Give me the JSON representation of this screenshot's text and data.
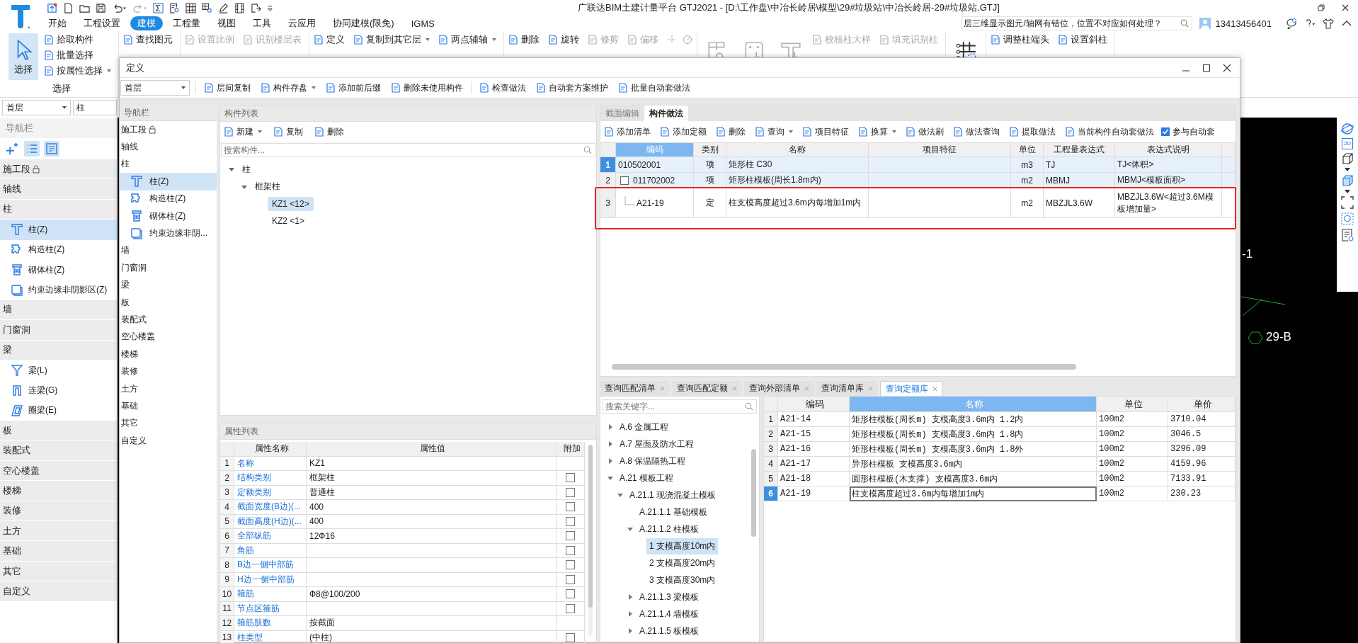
{
  "app": {
    "title": "广联达BIM土建计量平台 GTJ2021 - [D:\\工作盘\\中冶长岭居\\模型\\29#垃圾站\\中冶长岭居-29#垃圾站.GTJ]",
    "menu_tabs": [
      {
        "label": "开始",
        "selected": false
      },
      {
        "label": "工程设置",
        "selected": false
      },
      {
        "label": "建模",
        "selected": true
      },
      {
        "label": "工程量",
        "selected": false
      },
      {
        "label": "视图",
        "selected": false
      },
      {
        "label": "工具",
        "selected": false
      },
      {
        "label": "云应用",
        "selected": false
      },
      {
        "label": "协同建模(限免)",
        "selected": false
      },
      {
        "label": "IGMS",
        "selected": false
      }
    ],
    "help_search": {
      "value": "层三维显示图元/轴网有错位，位置不对应如何处理？"
    },
    "user": "13413456401"
  },
  "ribbon": [
    {
      "label": "选择",
      "large": [
        {
          "label": "选择",
          "kind": "pointer",
          "selected": true,
          "disabled": false
        }
      ],
      "cols": [
        [
          {
            "label": "拾取构件",
            "disabled": false,
            "dropdown": false
          },
          {
            "label": "批量选择",
            "disabled": false,
            "dropdown": false
          },
          {
            "label": "按属性选择",
            "disabled": false,
            "dropdown": true
          }
        ]
      ]
    },
    {
      "cols": [
        [
          {
            "label": "查找图元",
            "disabled": false,
            "dropdown": false
          }
        ]
      ]
    },
    {
      "cols": [
        [
          {
            "label": "设置比例",
            "disabled": true,
            "dropdown": false
          }
        ],
        [
          {
            "label": "识别楼层表",
            "disabled": true,
            "dropdown": false
          }
        ]
      ]
    },
    {
      "cols": [
        [
          {
            "label": "定义",
            "disabled": false,
            "dropdown": false
          }
        ],
        [
          {
            "label": "复制到其它层",
            "disabled": false,
            "dropdown": true
          }
        ],
        [
          {
            "label": "两点辅轴",
            "disabled": false,
            "dropdown": true
          }
        ]
      ]
    },
    {
      "cols": [
        [
          {
            "label": "删除",
            "disabled": false,
            "dropdown": false
          }
        ],
        [
          {
            "label": "旋转",
            "disabled": false,
            "dropdown": false
          }
        ],
        [
          {
            "label": "修剪",
            "disabled": true,
            "dropdown": false
          }
        ],
        [
          {
            "label": "偏移",
            "disabled": true,
            "dropdown": false
          }
        ]
      ]
    },
    {
      "large": [
        {
          "kind": "grid-search",
          "selected": false,
          "disabled": true
        },
        {
          "kind": "point-box",
          "selected": false,
          "disabled": true
        },
        {
          "kind": "column-pick",
          "selected": false,
          "disabled": true
        }
      ],
      "cols": [
        [
          {
            "label": "校核柱大样",
            "disabled": true,
            "dropdown": false
          }
        ],
        [
          {
            "label": "填充识别柱",
            "disabled": true,
            "dropdown": false
          }
        ]
      ]
    },
    {
      "large": [
        {
          "kind": "axis-grid",
          "selected": false,
          "disabled": false
        }
      ]
    },
    {
      "cols": [
        [
          {
            "label": "调整柱端头",
            "disabled": false,
            "dropdown": false
          }
        ],
        [
          {
            "label": "设置斜柱",
            "disabled": false,
            "dropdown": false
          }
        ]
      ]
    }
  ],
  "floor_select": {
    "value": "首层"
  },
  "type_select": {
    "value": "柱"
  },
  "nav": {
    "title": "导航栏",
    "groups": [
      {
        "label": "施工段",
        "locked": true
      },
      {
        "label": "轴线",
        "locked": false
      },
      {
        "label": "柱",
        "locked": false,
        "children": [
          {
            "label": "柱(Z)",
            "kind": "column",
            "selected": true
          },
          {
            "label": "构造柱(Z)",
            "kind": "constructional",
            "selected": false
          },
          {
            "label": "砌体柱(Z)",
            "kind": "masonry",
            "selected": false
          },
          {
            "label": "约束边缘非阴影区(Z)",
            "kind": "edge",
            "selected": false
          }
        ]
      },
      {
        "label": "墙",
        "locked": false
      },
      {
        "label": "门窗洞",
        "locked": false
      },
      {
        "label": "梁",
        "locked": false,
        "children": [
          {
            "label": "梁(L)",
            "kind": "beam",
            "selected": false
          },
          {
            "label": "连梁(G)",
            "kind": "link-beam",
            "selected": false
          },
          {
            "label": "圈梁(E)",
            "kind": "ring-beam",
            "selected": false
          }
        ]
      },
      {
        "label": "板",
        "locked": false
      },
      {
        "label": "装配式",
        "locked": false
      },
      {
        "label": "空心楼盖",
        "locked": false
      },
      {
        "label": "楼梯",
        "locked": false
      },
      {
        "label": "装修",
        "locked": false
      },
      {
        "label": "土方",
        "locked": false
      },
      {
        "label": "基础",
        "locked": false
      },
      {
        "label": "其它",
        "locked": false
      },
      {
        "label": "自定义",
        "locked": false
      }
    ]
  },
  "canvas": {
    "labels": [
      "-1",
      "29-B"
    ],
    "view_label": "2D"
  },
  "dialog": {
    "title": "定义",
    "floor": "首层",
    "tools": [
      [
        {
          "label": "层间复制",
          "dropdown": false
        },
        {
          "label": "构件存盘",
          "dropdown": true
        },
        {
          "label": "添加前后缀",
          "dropdown": false
        },
        {
          "label": "删除未使用构件",
          "dropdown": false
        }
      ],
      [
        {
          "label": "检查做法",
          "dropdown": false
        },
        {
          "label": "自动套方案维护",
          "dropdown": false
        },
        {
          "label": "批量自动套做法",
          "dropdown": false
        }
      ]
    ],
    "nav": {
      "title": "导航栏",
      "groups": [
        {
          "label": "施工段",
          "locked": true
        },
        {
          "label": "轴线",
          "locked": false
        },
        {
          "label": "柱",
          "locked": false,
          "children": [
            {
              "label": "柱(Z)",
              "kind": "column",
              "selected": true
            },
            {
              "label": "构造柱(Z)",
              "kind": "constructional",
              "selected": false
            },
            {
              "label": "砌体柱(Z)",
              "kind": "masonry",
              "selected": false
            },
            {
              "label": "约束边缘非阴...",
              "kind": "edge",
              "selected": false
            }
          ]
        },
        {
          "label": "墙",
          "locked": false
        },
        {
          "label": "门窗洞",
          "locked": false
        },
        {
          "label": "梁",
          "locked": false
        },
        {
          "label": "板",
          "locked": false
        },
        {
          "label": "装配式",
          "locked": false
        },
        {
          "label": "空心楼盖",
          "locked": false
        },
        {
          "label": "楼梯",
          "locked": false
        },
        {
          "label": "装修",
          "locked": false
        },
        {
          "label": "土方",
          "locked": false
        },
        {
          "label": "基础",
          "locked": false
        },
        {
          "label": "其它",
          "locked": false
        },
        {
          "label": "自定义",
          "locked": false
        }
      ]
    },
    "component_list": {
      "title": "构件列表",
      "tools": [
        {
          "label": "新建",
          "dropdown": true
        },
        {
          "label": "复制",
          "dropdown": false
        },
        {
          "label": "删除",
          "dropdown": false
        }
      ],
      "search": {
        "placeholder": "搜索构件..."
      },
      "tree": [
        {
          "label": "柱",
          "expanded": true,
          "selected": false,
          "children": [
            {
              "label": "框架柱",
              "expanded": true,
              "selected": false,
              "children": [
                {
                  "label": "KZ1 <12>",
                  "selected": true
                },
                {
                  "label": "KZ2 <1>",
                  "selected": false
                }
              ]
            }
          ]
        }
      ]
    },
    "properties": {
      "title": "属性列表",
      "columns": [
        "属性名称",
        "属性值",
        "附加"
      ],
      "rows": [
        {
          "num": "1",
          "name": "名称",
          "value": "KZ1"
        },
        {
          "num": "2",
          "name": "结构类别",
          "value": "框架柱",
          "checked": false
        },
        {
          "num": "3",
          "name": "定额类别",
          "value": "普通柱",
          "checked": false
        },
        {
          "num": "4",
          "name": "截面宽度(B边)(...",
          "value": "400",
          "checked": false
        },
        {
          "num": "5",
          "name": "截面高度(H边)(...",
          "value": "400",
          "checked": false
        },
        {
          "num": "6",
          "name": "全部纵筋",
          "value": "12Ф16",
          "checked": false
        },
        {
          "num": "7",
          "name": "角筋",
          "checked": false
        },
        {
          "num": "8",
          "name": "B边一侧中部筋",
          "checked": false
        },
        {
          "num": "9",
          "name": "H边一侧中部筋",
          "checked": false
        },
        {
          "num": "10",
          "name": "箍筋",
          "value": "Ф8@100/200",
          "checked": false
        },
        {
          "num": "11",
          "name": "节点区箍筋",
          "checked": false
        },
        {
          "num": "12",
          "name": "箍筋肢数",
          "value": "按截面"
        },
        {
          "num": "13",
          "name": "柱类型",
          "value": "(中柱)",
          "checked": false
        }
      ]
    },
    "methods": {
      "tabs": [
        {
          "label": "截面编辑",
          "selected": false
        },
        {
          "label": "构件做法",
          "selected": true
        }
      ],
      "tools": [
        {
          "label": "添加清单",
          "dropdown": false
        },
        {
          "label": "添加定额",
          "dropdown": false
        },
        {
          "label": "删除",
          "dropdown": false
        },
        {
          "label": "查询",
          "dropdown": true
        },
        {
          "label": "项目特征",
          "dropdown": false
        },
        {
          "label": "换算",
          "dropdown": true
        },
        {
          "label": "做法刷",
          "dropdown": false
        },
        {
          "label": "做法查询",
          "dropdown": false
        },
        {
          "label": "提取做法",
          "dropdown": false
        },
        {
          "label": "当前构件自动套做法",
          "dropdown": false
        }
      ],
      "auto_apply": {
        "label": "参与自动套",
        "checked": true
      },
      "columns": [
        {
          "label": "编码",
          "selected": true
        },
        {
          "label": "类别",
          "selected": false
        },
        {
          "label": "名称",
          "selected": false
        },
        {
          "label": "项目特征",
          "selected": false
        },
        {
          "label": "单位",
          "selected": false
        },
        {
          "label": "工程量表达式",
          "selected": false
        },
        {
          "label": "表达式说明",
          "selected": false
        }
      ],
      "rows": [
        {
          "num": "1",
          "kind": "list",
          "selected": true,
          "code": "010502001",
          "type": "项",
          "name": "矩形柱 C30",
          "unit": "m3",
          "expr": "TJ",
          "desc": "TJ<体积>"
        },
        {
          "num": "2",
          "kind": "list",
          "selected": false,
          "expanded": true,
          "code": "011702002",
          "type": "项",
          "name": "矩形柱模板(周长1.8m内)",
          "unit": "m2",
          "expr": "MBMJ",
          "desc": "MBMJ<模板面积>"
        },
        {
          "num": "3",
          "kind": "quota",
          "selected": false,
          "code": "A21-19",
          "type": "定",
          "name": "柱支模高度超过3.6m内每增加1m内",
          "unit": "m2",
          "expr": "MBZJL3.6W",
          "desc": "MBZJL3.6W<超过3.6M模板增加量>"
        }
      ]
    },
    "query": {
      "tabs": [
        {
          "label": "查询匹配清单",
          "selected": false
        },
        {
          "label": "查询匹配定额",
          "selected": false
        },
        {
          "label": "查询外部清单",
          "selected": false
        },
        {
          "label": "查询清单库",
          "selected": false
        },
        {
          "label": "查询定额库",
          "selected": true
        }
      ],
      "search": {
        "placeholder": "搜索关键字..."
      },
      "tree": [
        {
          "label": "A.6 金属工程",
          "expanded": false,
          "selected": false
        },
        {
          "label": "A.7 屋面及防水工程",
          "expanded": false,
          "selected": false
        },
        {
          "label": "A.8 保温隔热工程",
          "expanded": false,
          "selected": false
        },
        {
          "label": "A.21 模板工程",
          "expanded": true,
          "selected": false,
          "children": [
            {
              "label": "A.21.1 现浇混凝土模板",
              "expanded": true,
              "selected": false,
              "children": [
                {
                  "label": "A.21.1.1 基础模板",
                  "selected": false
                },
                {
                  "label": "A.21.1.2 柱模板",
                  "expanded": true,
                  "selected": false,
                  "children": [
                    {
                      "label": "1 支模高度10m内",
                      "selected": true
                    },
                    {
                      "label": "2 支模高度20m内",
                      "selected": false
                    },
                    {
                      "label": "3 支模高度30m内",
                      "selected": false
                    }
                  ]
                },
                {
                  "label": "A.21.1.3 梁模板",
                  "expanded": false,
                  "selected": false
                },
                {
                  "label": "A.21.1.4 墙模板",
                  "expanded": false,
                  "selected": false
                },
                {
                  "label": "A.21.1.5 板模板",
                  "expanded": false,
                  "selected": false
                }
              ]
            }
          ]
        }
      ],
      "columns": [
        {
          "label": "编码",
          "selected": false
        },
        {
          "label": "名称",
          "selected": true
        },
        {
          "label": "单位",
          "selected": false
        },
        {
          "label": "单价",
          "selected": false
        }
      ],
      "rows": [
        {
          "num": "1",
          "code": "A21-14",
          "name": "矩形柱模板(周长m) 支模高度3.6m内 1.2内",
          "unit": "100m2",
          "price": "3710.04",
          "selected": false
        },
        {
          "num": "2",
          "code": "A21-15",
          "name": "矩形柱模板(周长m) 支模高度3.6m内 1.8内",
          "unit": "100m2",
          "price": "3046.5",
          "selected": false
        },
        {
          "num": "3",
          "code": "A21-16",
          "name": "矩形柱模板(周长m) 支模高度3.6m内 1.8外",
          "unit": "100m2",
          "price": "3296.09",
          "selected": false
        },
        {
          "num": "4",
          "code": "A21-17",
          "name": "异形柱模板 支模高度3.6m内",
          "unit": "100m2",
          "price": "4159.96",
          "selected": false
        },
        {
          "num": "5",
          "code": "A21-18",
          "name": "圆形柱模板(木支撑) 支模高度3.6m内",
          "unit": "100m2",
          "price": "7133.91",
          "selected": false
        },
        {
          "num": "6",
          "code": "A21-19",
          "name": "柱支模高度超过3.6m内每增加1m内",
          "unit": "100m2",
          "price": "230.23",
          "selected": true
        }
      ]
    }
  }
}
